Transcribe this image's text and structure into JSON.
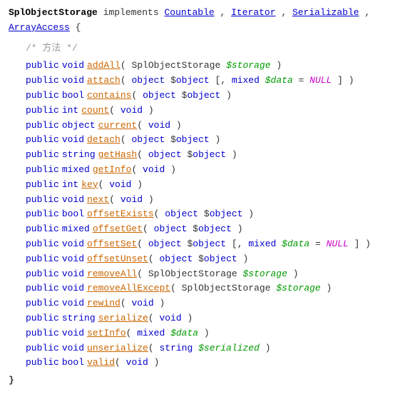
{
  "header": {
    "class_name": "SplObjectStorage",
    "implements_label": "implements",
    "interfaces": [
      "Countable",
      "Iterator",
      "Serializable",
      "ArrayAccess"
    ],
    "open_brace": "{"
  },
  "section_comment": "/* 方法 */",
  "methods": [
    {
      "visibility": "public",
      "return_type": "void",
      "name": "addAll",
      "params": "( SplObjectStorage $storage )"
    },
    {
      "visibility": "public",
      "return_type": "void",
      "name": "attach",
      "params": "( object $object [, mixed $data = NULL ] )"
    },
    {
      "visibility": "public",
      "return_type": "bool",
      "name": "contains",
      "params": "( object $object )"
    },
    {
      "visibility": "public",
      "return_type": "int",
      "name": "count",
      "params": "( void )"
    },
    {
      "visibility": "public",
      "return_type": "object",
      "name": "current",
      "params": "( void )"
    },
    {
      "visibility": "public",
      "return_type": "void",
      "name": "detach",
      "params": "( object $object )"
    },
    {
      "visibility": "public",
      "return_type": "string",
      "name": "getHash",
      "params": "( object $object )"
    },
    {
      "visibility": "public",
      "return_type": "mixed",
      "name": "getInfo",
      "params": "( void )"
    },
    {
      "visibility": "public",
      "return_type": "int",
      "name": "key",
      "params": "( void )"
    },
    {
      "visibility": "public",
      "return_type": "void",
      "name": "next",
      "params": "( void )"
    },
    {
      "visibility": "public",
      "return_type": "bool",
      "name": "offsetExists",
      "params": "( object $object )"
    },
    {
      "visibility": "public",
      "return_type": "mixed",
      "name": "offsetGet",
      "params": "( object $object )"
    },
    {
      "visibility": "public",
      "return_type": "void",
      "name": "offsetSet",
      "params": "( object $object [, mixed $data = NULL ] )"
    },
    {
      "visibility": "public",
      "return_type": "void",
      "name": "offsetUnset",
      "params": "( object $object )"
    },
    {
      "visibility": "public",
      "return_type": "void",
      "name": "removeAll",
      "params": "( SplObjectStorage $storage )"
    },
    {
      "visibility": "public",
      "return_type": "void",
      "name": "removeAllExcept",
      "params": "( SplObjectStorage $storage )"
    },
    {
      "visibility": "public",
      "return_type": "void",
      "name": "rewind",
      "params": "( void )"
    },
    {
      "visibility": "public",
      "return_type": "string",
      "name": "serialize",
      "params": "( void )"
    },
    {
      "visibility": "public",
      "return_type": "void",
      "name": "setInfo",
      "params": "( mixed $data )"
    },
    {
      "visibility": "public",
      "return_type": "void",
      "name": "unserialize",
      "params": "( string $serialized )"
    },
    {
      "visibility": "public",
      "return_type": "bool",
      "name": "valid",
      "params": "( void )"
    }
  ],
  "closing_brace": "}"
}
